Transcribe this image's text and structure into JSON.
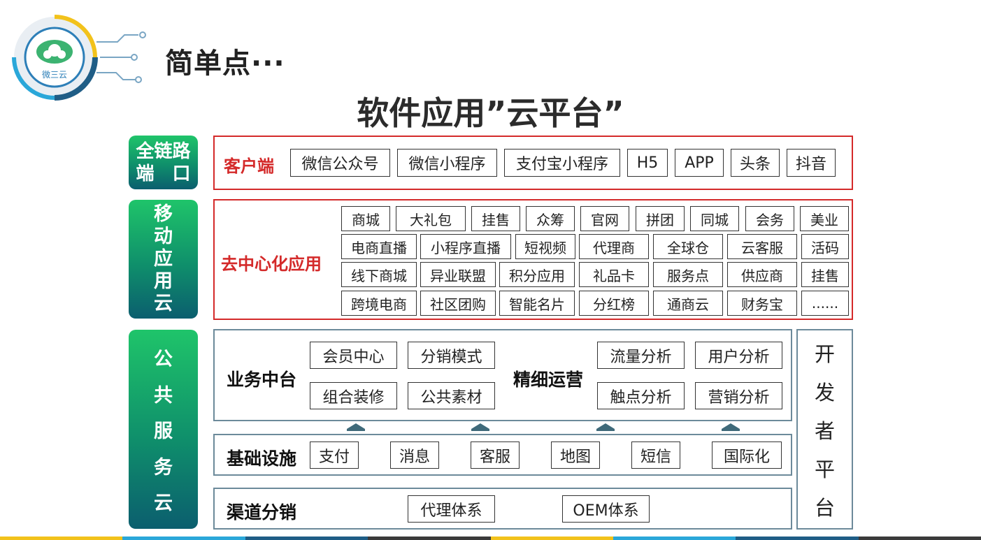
{
  "header": {
    "logo_text": "微三云",
    "slide_title": "简单点···",
    "main_title": "软件应用”云平台”"
  },
  "pills": {
    "p1": [
      "全链路",
      "端　口"
    ],
    "p2": [
      "移",
      "动",
      "应",
      "用",
      "云"
    ],
    "p3": [
      "公",
      "共",
      "服",
      "务",
      "云"
    ]
  },
  "client": {
    "label": "客户端",
    "items": [
      "微信公众号",
      "微信小程序",
      "支付宝小程序",
      "H5",
      "APP",
      "头条",
      "抖音"
    ]
  },
  "decentral": {
    "label": "去中心化应用",
    "row1": [
      "商城",
      "大礼包",
      "挂售",
      "众筹",
      "官网",
      "拼团",
      "同城",
      "会务",
      "美业"
    ],
    "row2": [
      "电商直播",
      "小程序直播",
      "短视频",
      "代理商",
      "全球仓",
      "云客服",
      "活码"
    ],
    "row3": [
      "线下商城",
      "异业联盟",
      "积分应用",
      "礼品卡",
      "服务点",
      "供应商",
      "挂售"
    ],
    "row4": [
      "跨境电商",
      "社区团购",
      "智能名片",
      "分红榜",
      "通商云",
      "财务宝",
      "......"
    ]
  },
  "business": {
    "label": "业务中台",
    "items": [
      "会员中心",
      "分销模式",
      "组合装修",
      "公共素材"
    ],
    "ops_label": "精细运营",
    "ops_items": [
      "流量分析",
      "用户分析",
      "触点分析",
      "营销分析"
    ]
  },
  "infra": {
    "label": "基础设施",
    "items": [
      "支付",
      "消息",
      "客服",
      "地图",
      "短信",
      "国际化"
    ]
  },
  "channel": {
    "label": "渠道分销",
    "items": [
      "代理体系",
      "OEM体系"
    ]
  },
  "developer": {
    "chars": [
      "开",
      "发",
      "者",
      "平",
      "台"
    ]
  },
  "colors": {
    "red": "#d42a2a",
    "green_top": "#1fc46a",
    "teal_bottom": "#0b5e6e",
    "gray_border": "#6c8a9a"
  }
}
